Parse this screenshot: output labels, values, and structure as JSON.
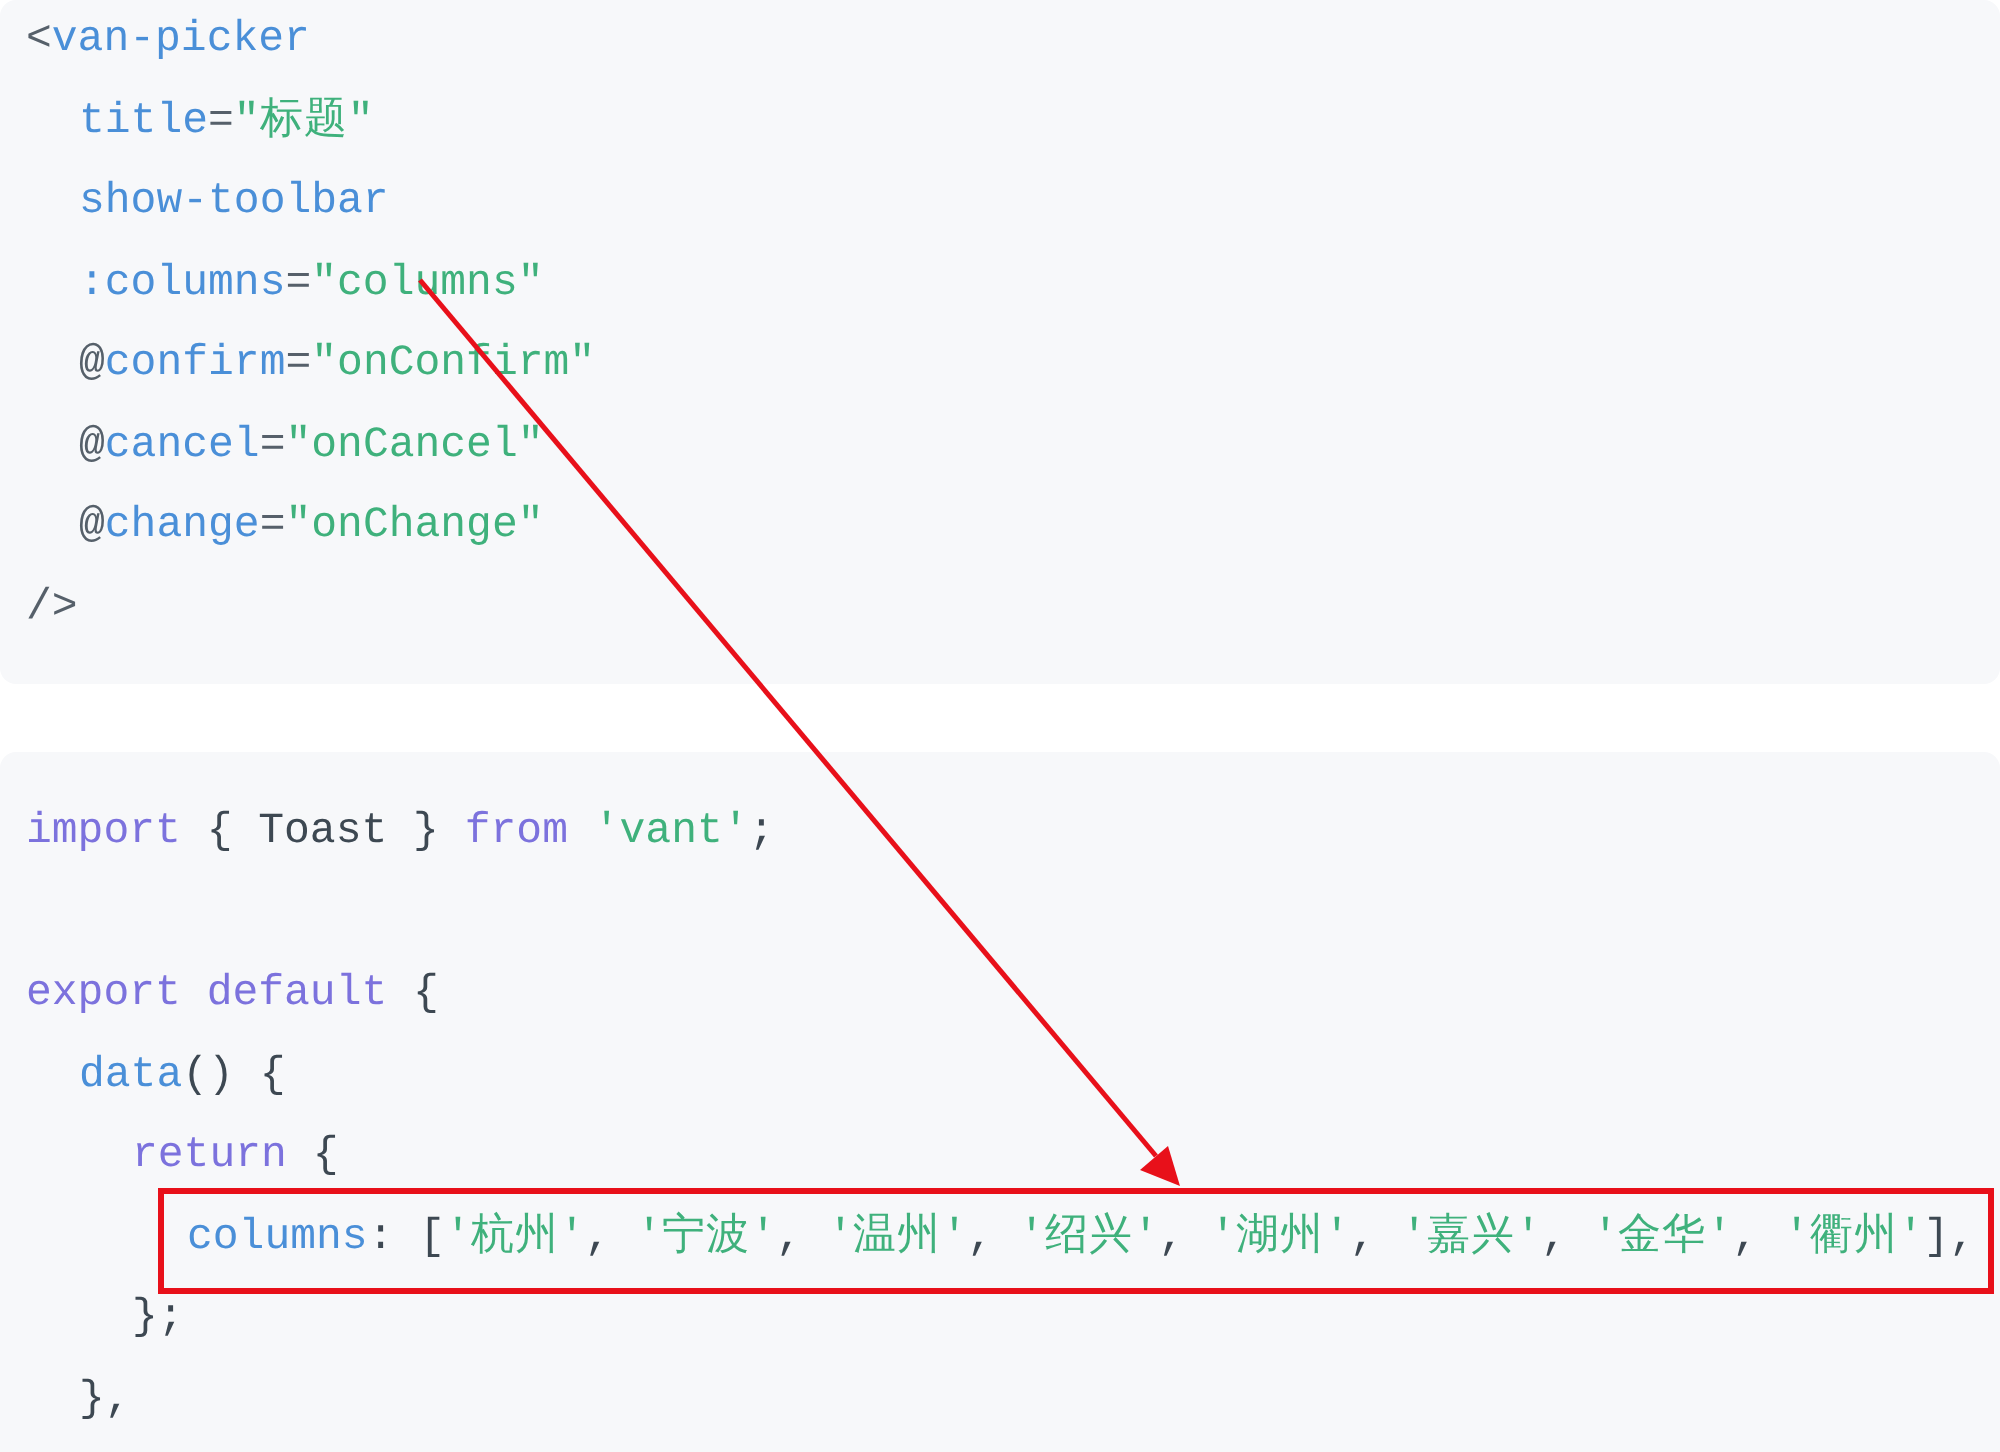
{
  "code_blocks": [
    {
      "lines": [
        {
          "tokens": [
            {
              "kind": "punct",
              "text": "<"
            },
            {
              "kind": "tag",
              "text": "van-picker"
            }
          ],
          "children": [
            {
              "tokens": [
                {
                  "kind": "attr",
                  "text": "title"
                },
                {
                  "kind": "punct",
                  "text": "="
                },
                {
                  "kind": "string",
                  "text": "\"标题\""
                }
              ]
            },
            {
              "tokens": [
                {
                  "kind": "attr",
                  "text": "show-toolbar"
                }
              ]
            },
            {
              "tokens": [
                {
                  "kind": "attr",
                  "text": ":columns"
                },
                {
                  "kind": "punct",
                  "text": "="
                },
                {
                  "kind": "string",
                  "text": "\"columns\""
                }
              ]
            },
            {
              "tokens": [
                {
                  "kind": "punct",
                  "text": "@"
                },
                {
                  "kind": "attr",
                  "text": "confirm"
                },
                {
                  "kind": "punct",
                  "text": "="
                },
                {
                  "kind": "string",
                  "text": "\"onConfirm\""
                }
              ]
            },
            {
              "tokens": [
                {
                  "kind": "punct",
                  "text": "@"
                },
                {
                  "kind": "attr",
                  "text": "cancel"
                },
                {
                  "kind": "punct",
                  "text": "="
                },
                {
                  "kind": "string",
                  "text": "\"onCancel\""
                }
              ]
            },
            {
              "tokens": [
                {
                  "kind": "punct",
                  "text": "@"
                },
                {
                  "kind": "attr",
                  "text": "change"
                },
                {
                  "kind": "punct",
                  "text": "="
                },
                {
                  "kind": "string",
                  "text": "\"onChange\""
                }
              ]
            }
          ]
        },
        {
          "tokens": [
            {
              "kind": "punct",
              "text": "/>"
            }
          ]
        }
      ]
    },
    {
      "lines": [
        {
          "tokens": [
            {
              "kind": "keyword",
              "text": "import"
            },
            {
              "kind": "plain",
              "text": " { Toast } "
            },
            {
              "kind": "keyword",
              "text": "from"
            },
            {
              "kind": "string",
              "text": " 'vant'"
            },
            {
              "kind": "plain",
              "text": ";"
            }
          ]
        },
        {
          "spaced": true,
          "tokens": [
            {
              "kind": "keyword",
              "text": "export default"
            },
            {
              "kind": "plain",
              "text": " {"
            }
          ],
          "children": [
            {
              "tokens": [
                {
                  "kind": "attr",
                  "text": "data"
                },
                {
                  "kind": "plain",
                  "text": "() {"
                }
              ],
              "children": [
                {
                  "tokens": [
                    {
                      "kind": "keyword",
                      "text": "return"
                    },
                    {
                      "kind": "plain",
                      "text": " {"
                    }
                  ],
                  "children": [
                    {
                      "highlighted": true,
                      "tokens": [
                        {
                          "kind": "attr",
                          "text": "columns"
                        },
                        {
                          "kind": "plain",
                          "text": ": ["
                        },
                        {
                          "kind": "string",
                          "text": "'杭州'"
                        },
                        {
                          "kind": "plain",
                          "text": ", "
                        },
                        {
                          "kind": "string",
                          "text": "'宁波'"
                        },
                        {
                          "kind": "plain",
                          "text": ", "
                        },
                        {
                          "kind": "string",
                          "text": "'温州'"
                        },
                        {
                          "kind": "plain",
                          "text": ", "
                        },
                        {
                          "kind": "string",
                          "text": "'绍兴'"
                        },
                        {
                          "kind": "plain",
                          "text": ", "
                        },
                        {
                          "kind": "string",
                          "text": "'湖州'"
                        },
                        {
                          "kind": "plain",
                          "text": ", "
                        },
                        {
                          "kind": "string",
                          "text": "'嘉兴'"
                        },
                        {
                          "kind": "plain",
                          "text": ", "
                        },
                        {
                          "kind": "string",
                          "text": "'金华'"
                        },
                        {
                          "kind": "plain",
                          "text": ", "
                        },
                        {
                          "kind": "string",
                          "text": "'衢州'"
                        },
                        {
                          "kind": "plain",
                          "text": "],"
                        }
                      ]
                    }
                  ]
                },
                {
                  "tokens": [
                    {
                      "kind": "plain",
                      "text": "};"
                    }
                  ]
                }
              ]
            },
            {
              "tokens": [
                {
                  "kind": "plain",
                  "text": "},"
                }
              ]
            }
          ]
        }
      ]
    }
  ],
  "annotation": {
    "kind": "arrow"
  }
}
